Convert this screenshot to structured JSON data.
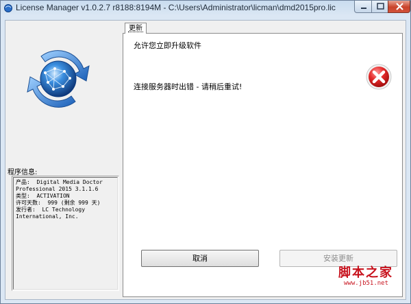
{
  "window": {
    "title": "License Manager v1.0.2.7 r8188:8194M - C:\\Users\\Administrator\\licman\\dmd2015pro.lic",
    "icon": "app-icon",
    "controls": [
      "minimize-icon",
      "maximize-icon",
      "close-icon"
    ]
  },
  "sidebar": {
    "logo": "globe-refresh-arrows",
    "info_label": "程序信息:",
    "info_text": "产品:  Digital Media Doctor\nProfessional 2015 3.1.1.6\n类型:  ACTIVATION\n许可天数:  999 (剩余 999 天)\n发行者:  LC Technology\nInternational, Inc."
  },
  "tab": {
    "label": "更新"
  },
  "panel": {
    "message_title": "允许您立即升级软件",
    "error_message": "连接服务器时出错 - 请稍后重试!",
    "error_icon": "error-x-icon"
  },
  "buttons": {
    "cancel": "取消",
    "install_update": "安装更新"
  },
  "watermark": {
    "text": "脚本之家",
    "url": "www.jb51.net"
  },
  "colors": {
    "accent_red": "#c7121d",
    "error_red": "#e52b2b",
    "titlebar": "#c9dcef"
  }
}
